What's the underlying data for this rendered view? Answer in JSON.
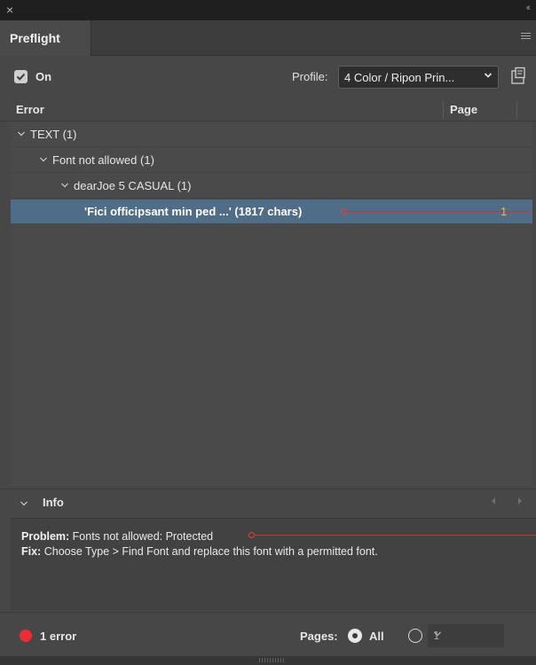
{
  "window": {
    "close_glyph": "×",
    "collapse_glyph": "‹‹"
  },
  "tabs": [
    {
      "label": "Preflight"
    }
  ],
  "toolbar": {
    "on_label": "On",
    "on_checked": true,
    "profile_label": "Profile:",
    "profile_value": "4 Color / Ripon Prin..."
  },
  "columns": {
    "error": "Error",
    "page": "Page"
  },
  "tree": {
    "rows": [
      {
        "label": "TEXT (1)",
        "expanded": true
      },
      {
        "label": "Font not allowed (1)",
        "expanded": true
      },
      {
        "label": "dearJoe 5 CASUAL (1)",
        "expanded": true
      },
      {
        "label": "'Fici officipsant min ped ...' (1817 chars)",
        "page": "1",
        "selected": true
      }
    ]
  },
  "info": {
    "title": "Info",
    "problem_label": "Problem:",
    "problem_text": "Fonts not allowed: Protected",
    "fix_label": "Fix:",
    "fix_text": "Choose Type > Find Font and replace this font with a permitted font."
  },
  "footer": {
    "error_count_label": "1 error",
    "pages_label": "Pages:",
    "all_label": "All",
    "all_selected": true,
    "range_value": "1"
  },
  "colors": {
    "selection": "#4f6d87",
    "error_red": "#ee2c36",
    "page_number": "#ffb52e",
    "marker_red": "#c8372c"
  },
  "icons": [
    "close-icon",
    "collapse-icon",
    "panel-menu-icon",
    "checkmark-icon",
    "chevron-down-icon",
    "profile-define-icon",
    "disclosure-caret-icon",
    "prev-arrow-icon",
    "next-arrow-icon",
    "error-dot-icon",
    "grip-icon"
  ]
}
